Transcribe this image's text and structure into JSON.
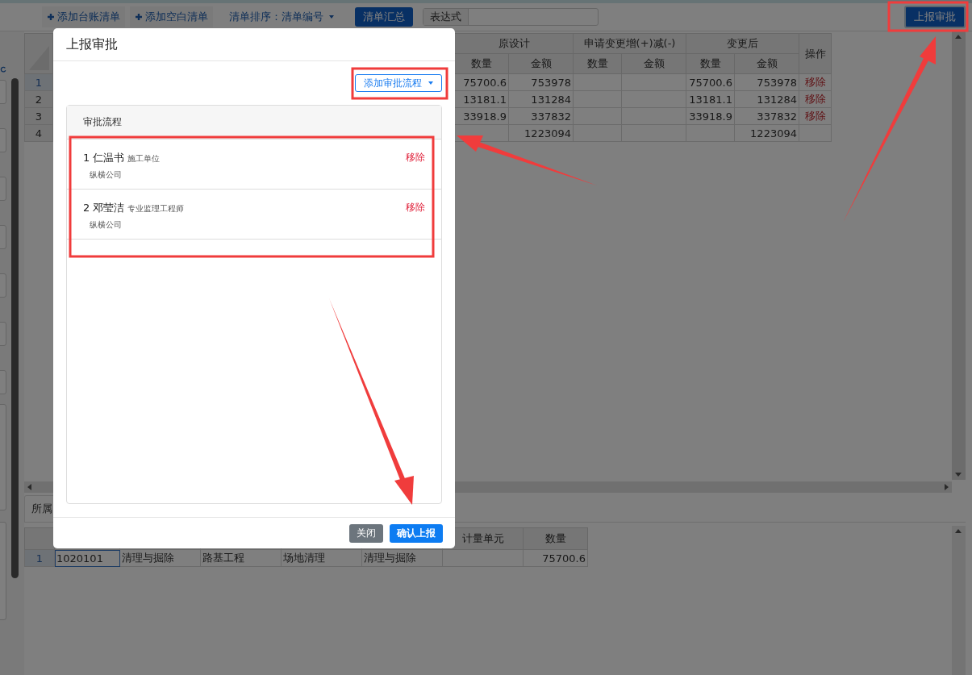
{
  "toolbar": {
    "add_buttons": [
      "添加台账清单",
      "添加空白清单"
    ],
    "sort": {
      "label": "清单排序：",
      "value": "清单编号"
    },
    "summary_button": "清单汇总",
    "expression": {
      "label": "表达式"
    },
    "report_button": "上报审批"
  },
  "top_grid": {
    "groups": [
      "原设计",
      "申请变更增(+)减(-)",
      "变更后"
    ],
    "subcolumns": [
      "数量",
      "金额",
      "数量",
      "金额",
      "数量",
      "金额"
    ],
    "action_column": "操作",
    "rows": [
      {
        "num": "1",
        "selected": true,
        "orig_qty": "75700.6",
        "orig_amount": "753978",
        "new_qty": "75700.6",
        "new_amount": "753978",
        "action": "移除"
      },
      {
        "num": "2",
        "selected": false,
        "orig_qty": "13181.1",
        "orig_amount": "131284",
        "new_qty": "13181.1",
        "new_amount": "131284",
        "action": "移除"
      },
      {
        "num": "3",
        "selected": false,
        "orig_qty": "33918.9",
        "orig_amount": "337832",
        "new_qty": "33918.9",
        "new_amount": "337832",
        "action": "移除"
      },
      {
        "num": "4",
        "selected": false,
        "orig_amount": "1223094",
        "new_amount": "1223094"
      }
    ]
  },
  "bottom_tabs": [
    "所属"
  ],
  "bottom_grid": {
    "columns": [
      "计量单元",
      "数量"
    ],
    "rows": [
      {
        "num": "1",
        "column_1": "1020101",
        "column_2": "清理与掘除",
        "column_3": "路基工程",
        "column_4": "场地清理",
        "column_5": "清理与掘除",
        "quantity": "75700.6"
      }
    ]
  },
  "dialog": {
    "title": "上报审批",
    "add_button": "添加审批流程",
    "card_title": "审批流程",
    "steps": [
      {
        "index": "1",
        "name": "仁温书",
        "role": "施工单位",
        "company": "纵横公司",
        "action": "移除"
      },
      {
        "index": "2",
        "name": "邓莹洁",
        "role": "专业监理工程师",
        "company": "纵横公司",
        "action": "移除"
      }
    ],
    "close_button": "关闭",
    "confirm_button": "确认上报"
  }
}
